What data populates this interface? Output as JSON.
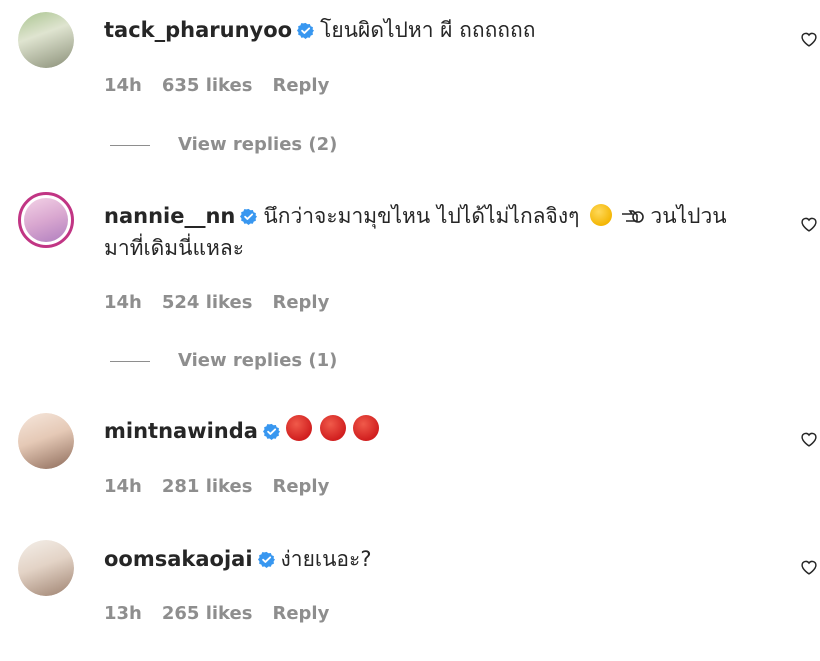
{
  "comments": [
    {
      "username": "tack_pharunyoo",
      "text": "โยนผิดไปหา ผี ถถถถถถ",
      "time": "14h",
      "likes": "635 likes",
      "reply_label": "Reply",
      "view_replies": "View replies (2)"
    },
    {
      "username": "nannie__nn",
      "text_part1": "นึกว่าจะมามุขไหน ไปได้ไม่ไกลจิงๆ",
      "text_part2": "วนไปวน",
      "text_line2": "มาที่เดิมนี่แหละ",
      "time": "14h",
      "likes": "524 likes",
      "reply_label": "Reply",
      "view_replies": "View replies (1)"
    },
    {
      "username": "mintnawinda",
      "time": "14h",
      "likes": "281 likes",
      "reply_label": "Reply"
    },
    {
      "username": "oomsakaojai",
      "text": "ง่ายเนอะ?",
      "time": "13h",
      "likes": "265 likes",
      "reply_label": "Reply"
    }
  ],
  "colors": {
    "text": "#262626",
    "secondary": "#8e8e8e",
    "verified": "#3897f0",
    "story_ring": "#c13584"
  },
  "icons": [
    "verified-badge-icon",
    "heart-icon",
    "angry-face-emoji",
    "shocked-face-emoji",
    "pointing-hand-emoji"
  ]
}
